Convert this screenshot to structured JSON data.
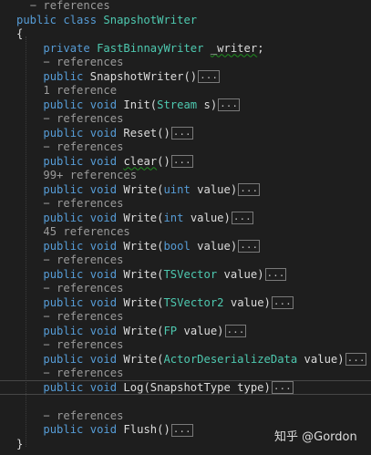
{
  "code_lines": [
    {
      "indent": "  ",
      "lens": "− references"
    },
    {
      "indent": "",
      "parts": [
        {
          "t": "public",
          "c": "kw"
        },
        {
          "t": " ",
          "c": "plain"
        },
        {
          "t": "class",
          "c": "kw"
        },
        {
          "t": " ",
          "c": "plain"
        },
        {
          "t": "SnapshotWriter",
          "c": "type"
        }
      ]
    },
    {
      "indent": "",
      "parts": [
        {
          "t": "{",
          "c": "plain"
        }
      ]
    },
    {
      "indent": "    ",
      "parts": [
        {
          "t": "private",
          "c": "kw"
        },
        {
          "t": " ",
          "c": "plain"
        },
        {
          "t": "FastBinnayWriter",
          "c": "type"
        },
        {
          "t": " ",
          "c": "plain"
        },
        {
          "t": "_writer",
          "c": "plain",
          "sq": "field"
        },
        {
          "t": ";",
          "c": "plain"
        }
      ]
    },
    {
      "indent": "    ",
      "lens": "− references"
    },
    {
      "indent": "    ",
      "parts": [
        {
          "t": "public",
          "c": "kw"
        },
        {
          "t": " SnapshotWriter()",
          "c": "plain"
        }
      ],
      "collapsed": true
    },
    {
      "indent": "    ",
      "lens": "1 reference"
    },
    {
      "indent": "    ",
      "parts": [
        {
          "t": "public",
          "c": "kw"
        },
        {
          "t": " ",
          "c": "plain"
        },
        {
          "t": "void",
          "c": "kw"
        },
        {
          "t": " Init(",
          "c": "plain"
        },
        {
          "t": "Stream",
          "c": "type"
        },
        {
          "t": " s)",
          "c": "plain"
        }
      ],
      "collapsed": true
    },
    {
      "indent": "    ",
      "lens": "− references"
    },
    {
      "indent": "    ",
      "parts": [
        {
          "t": "public",
          "c": "kw"
        },
        {
          "t": " ",
          "c": "plain"
        },
        {
          "t": "void",
          "c": "kw"
        },
        {
          "t": " Reset()",
          "c": "plain"
        }
      ],
      "collapsed": true
    },
    {
      "indent": "    ",
      "lens": "− references"
    },
    {
      "indent": "    ",
      "parts": [
        {
          "t": "public",
          "c": "kw"
        },
        {
          "t": " ",
          "c": "plain"
        },
        {
          "t": "void",
          "c": "kw"
        },
        {
          "t": " ",
          "c": "plain"
        },
        {
          "t": "clear",
          "c": "plain",
          "sq": "meth"
        },
        {
          "t": "()",
          "c": "plain"
        }
      ],
      "collapsed": true
    },
    {
      "indent": "    ",
      "lens": "99+ references"
    },
    {
      "indent": "    ",
      "parts": [
        {
          "t": "public",
          "c": "kw"
        },
        {
          "t": " ",
          "c": "plain"
        },
        {
          "t": "void",
          "c": "kw"
        },
        {
          "t": " Write(",
          "c": "plain"
        },
        {
          "t": "uint",
          "c": "kw"
        },
        {
          "t": " value)",
          "c": "plain"
        }
      ],
      "collapsed": true
    },
    {
      "indent": "    ",
      "lens": "− references"
    },
    {
      "indent": "    ",
      "parts": [
        {
          "t": "public",
          "c": "kw"
        },
        {
          "t": " ",
          "c": "plain"
        },
        {
          "t": "void",
          "c": "kw"
        },
        {
          "t": " Write(",
          "c": "plain"
        },
        {
          "t": "int",
          "c": "kw"
        },
        {
          "t": " value)",
          "c": "plain"
        }
      ],
      "collapsed": true
    },
    {
      "indent": "    ",
      "lens": "45 references"
    },
    {
      "indent": "    ",
      "parts": [
        {
          "t": "public",
          "c": "kw"
        },
        {
          "t": " ",
          "c": "plain"
        },
        {
          "t": "void",
          "c": "kw"
        },
        {
          "t": " Write(",
          "c": "plain"
        },
        {
          "t": "bool",
          "c": "kw"
        },
        {
          "t": " value)",
          "c": "plain"
        }
      ],
      "collapsed": true
    },
    {
      "indent": "    ",
      "lens": "− references"
    },
    {
      "indent": "    ",
      "parts": [
        {
          "t": "public",
          "c": "kw"
        },
        {
          "t": " ",
          "c": "plain"
        },
        {
          "t": "void",
          "c": "kw"
        },
        {
          "t": " Write(",
          "c": "plain"
        },
        {
          "t": "TSVector",
          "c": "type"
        },
        {
          "t": " value)",
          "c": "plain"
        }
      ],
      "collapsed": true
    },
    {
      "indent": "    ",
      "lens": "− references"
    },
    {
      "indent": "    ",
      "parts": [
        {
          "t": "public",
          "c": "kw"
        },
        {
          "t": " ",
          "c": "plain"
        },
        {
          "t": "void",
          "c": "kw"
        },
        {
          "t": " Write(",
          "c": "plain"
        },
        {
          "t": "TSVector2",
          "c": "type"
        },
        {
          "t": " value)",
          "c": "plain"
        }
      ],
      "collapsed": true
    },
    {
      "indent": "    ",
      "lens": "− references"
    },
    {
      "indent": "    ",
      "parts": [
        {
          "t": "public",
          "c": "kw"
        },
        {
          "t": " ",
          "c": "plain"
        },
        {
          "t": "void",
          "c": "kw"
        },
        {
          "t": " Write(",
          "c": "plain"
        },
        {
          "t": "FP",
          "c": "type"
        },
        {
          "t": " value)",
          "c": "plain"
        }
      ],
      "collapsed": true
    },
    {
      "indent": "    ",
      "lens": "− references"
    },
    {
      "indent": "    ",
      "parts": [
        {
          "t": "public",
          "c": "kw"
        },
        {
          "t": " ",
          "c": "plain"
        },
        {
          "t": "void",
          "c": "kw"
        },
        {
          "t": " Write(",
          "c": "plain"
        },
        {
          "t": "ActorDeserializeData",
          "c": "type"
        },
        {
          "t": " value)",
          "c": "plain"
        }
      ],
      "collapsed": true
    },
    {
      "indent": "    ",
      "lens": "− references"
    },
    {
      "indent": "    ",
      "parts": [
        {
          "t": "public",
          "c": "kw"
        },
        {
          "t": " ",
          "c": "plain"
        },
        {
          "t": "void",
          "c": "kw"
        },
        {
          "t": " Log(SnapshotType type)",
          "c": "plain"
        }
      ],
      "collapsed": true,
      "current": true
    },
    {
      "indent": "",
      "blank": true
    },
    {
      "indent": "    ",
      "lens": "− references"
    },
    {
      "indent": "    ",
      "parts": [
        {
          "t": "public",
          "c": "kw"
        },
        {
          "t": " ",
          "c": "plain"
        },
        {
          "t": "void",
          "c": "kw"
        },
        {
          "t": " Flush()",
          "c": "plain"
        }
      ],
      "collapsed": true
    },
    {
      "indent": "",
      "parts": [
        {
          "t": "}",
          "c": "plain"
        }
      ]
    }
  ],
  "collapsed_marker": "...",
  "watermark": "知乎 @Gordon"
}
